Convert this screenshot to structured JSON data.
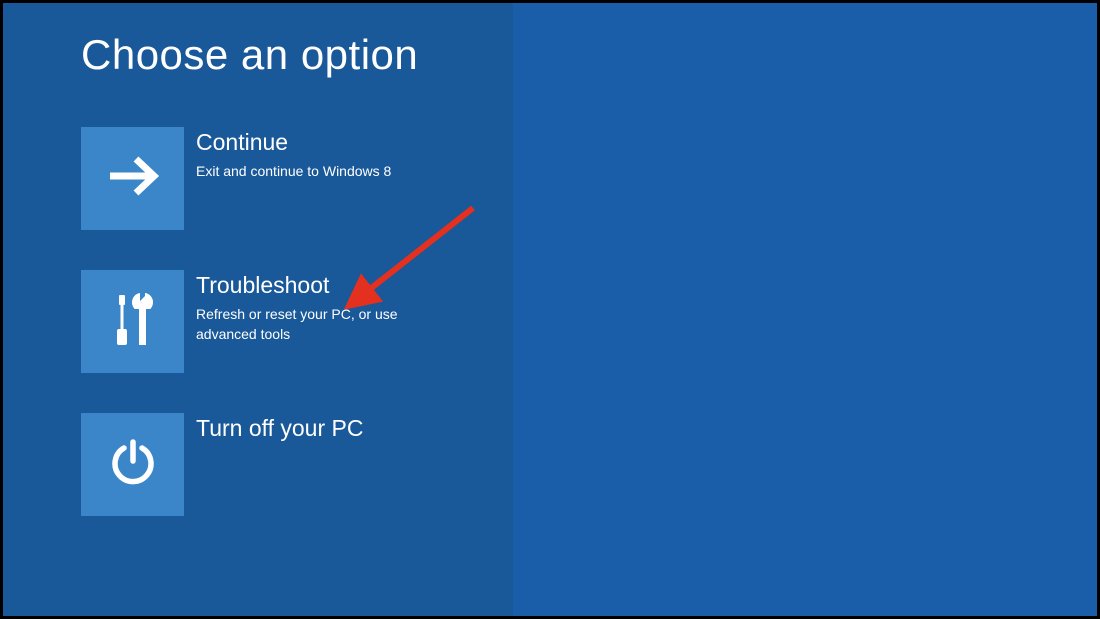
{
  "title": "Choose an option",
  "options": [
    {
      "icon": "arrow-right",
      "title": "Continue",
      "description": "Exit and continue to Windows 8"
    },
    {
      "icon": "tools",
      "title": "Troubleshoot",
      "description": "Refresh or reset your PC, or use advanced tools"
    },
    {
      "icon": "power",
      "title": "Turn off your PC",
      "description": ""
    }
  ],
  "annotation": {
    "type": "arrow",
    "color": "#e4301f",
    "target": "troubleshoot"
  }
}
